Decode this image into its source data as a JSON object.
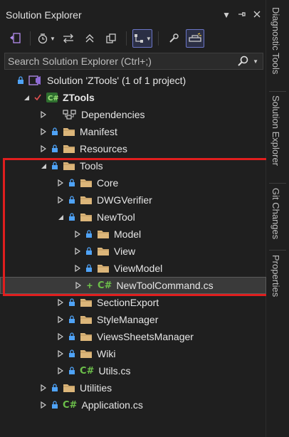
{
  "window": {
    "title": "Solution Explorer"
  },
  "search": {
    "placeholder": "Search Solution Explorer (Ctrl+;)"
  },
  "tree": [
    {
      "indent": 0,
      "expander": "none",
      "lock": true,
      "icon": "solution-icon",
      "label": "Solution 'ZTools' (1 of 1 project)",
      "bold": false
    },
    {
      "indent": 1,
      "expander": "expanded",
      "lock": false,
      "check": true,
      "icon": "csharp-project-icon",
      "label": "ZTools",
      "bold": true
    },
    {
      "indent": 2,
      "expander": "collapsed",
      "lock": false,
      "icon": "dependencies-icon",
      "label": "Dependencies",
      "bold": false
    },
    {
      "indent": 2,
      "expander": "collapsed",
      "lock": true,
      "icon": "folder-icon",
      "label": "Manifest",
      "bold": false
    },
    {
      "indent": 2,
      "expander": "collapsed",
      "lock": true,
      "icon": "folder-icon",
      "label": "Resources",
      "bold": false
    },
    {
      "indent": 2,
      "expander": "expanded",
      "lock": true,
      "icon": "folder-icon",
      "label": "Tools",
      "bold": false
    },
    {
      "indent": 3,
      "expander": "collapsed",
      "lock": true,
      "icon": "folder-icon",
      "label": "Core",
      "bold": false
    },
    {
      "indent": 3,
      "expander": "collapsed",
      "lock": true,
      "icon": "folder-icon",
      "label": "DWGVerifier",
      "bold": false
    },
    {
      "indent": 3,
      "expander": "expanded",
      "lock": true,
      "icon": "folder-icon",
      "label": "NewTool",
      "bold": false
    },
    {
      "indent": 4,
      "expander": "collapsed",
      "lock": true,
      "icon": "folder-icon",
      "label": "Model",
      "bold": false
    },
    {
      "indent": 4,
      "expander": "collapsed",
      "lock": true,
      "icon": "folder-icon",
      "label": "View",
      "bold": false
    },
    {
      "indent": 4,
      "expander": "collapsed",
      "lock": true,
      "icon": "folder-icon",
      "label": "ViewModel",
      "bold": false
    },
    {
      "indent": 4,
      "expander": "collapsed",
      "lock": false,
      "plus": true,
      "icon": "csharp-file-icon",
      "label": "NewToolCommand.cs",
      "bold": false,
      "selected": true
    },
    {
      "indent": 3,
      "expander": "collapsed",
      "lock": true,
      "icon": "folder-icon",
      "label": "SectionExport",
      "bold": false
    },
    {
      "indent": 3,
      "expander": "collapsed",
      "lock": true,
      "icon": "folder-icon",
      "label": "StyleManager",
      "bold": false
    },
    {
      "indent": 3,
      "expander": "collapsed",
      "lock": true,
      "icon": "folder-icon",
      "label": "ViewsSheetsManager",
      "bold": false
    },
    {
      "indent": 3,
      "expander": "collapsed",
      "lock": true,
      "icon": "folder-icon",
      "label": "Wiki",
      "bold": false
    },
    {
      "indent": 3,
      "expander": "collapsed",
      "lock": true,
      "icon": "csharp-file-icon",
      "label": "Utils.cs",
      "bold": false
    },
    {
      "indent": 2,
      "expander": "collapsed",
      "lock": true,
      "icon": "folder-icon",
      "label": "Utilities",
      "bold": false
    },
    {
      "indent": 2,
      "expander": "collapsed",
      "lock": true,
      "icon": "csharp-file-icon",
      "label": "Application.cs",
      "bold": false
    }
  ],
  "side_tabs": [
    {
      "label": "Diagnostic Tools"
    },
    {
      "label": "Solution Explorer"
    },
    {
      "label": "Git Changes"
    },
    {
      "label": "Properties"
    }
  ],
  "colors": {
    "background": "#1f1f1f",
    "highlight_box": "#e01e1e",
    "folder": "#dcb67a",
    "lock": "#4fa3f7",
    "csharp": "#6cc04a",
    "accent": "#6b76c7"
  }
}
